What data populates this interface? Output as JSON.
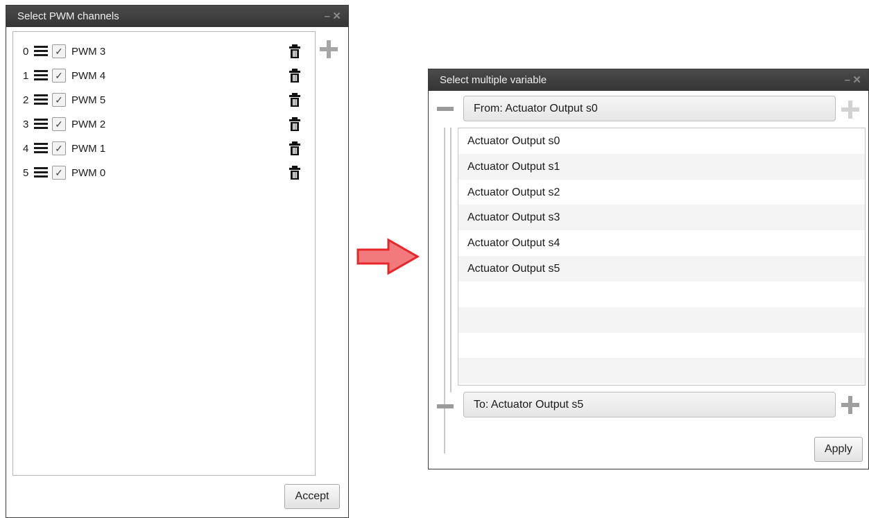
{
  "left_window": {
    "title": "Select PWM channels",
    "minimize": "–",
    "close": "✕",
    "channels": [
      {
        "index": "0",
        "label": "PWM 3",
        "checked": true
      },
      {
        "index": "1",
        "label": "PWM 4",
        "checked": true
      },
      {
        "index": "2",
        "label": "PWM 5",
        "checked": true
      },
      {
        "index": "3",
        "label": "PWM 2",
        "checked": true
      },
      {
        "index": "4",
        "label": "PWM 1",
        "checked": true
      },
      {
        "index": "5",
        "label": "PWM 0",
        "checked": true
      }
    ],
    "accept_label": "Accept"
  },
  "arrow": {
    "color": "#e8262a"
  },
  "right_window": {
    "title": "Select multiple variable",
    "minimize": "–",
    "close": "✕",
    "from_label": "From: Actuator Output s0",
    "to_label": "To: Actuator Output s5",
    "items": [
      "Actuator Output s0",
      "Actuator Output s1",
      "Actuator Output s2",
      "Actuator Output s3",
      "Actuator Output s4",
      "Actuator Output s5"
    ],
    "apply_label": "Apply"
  }
}
